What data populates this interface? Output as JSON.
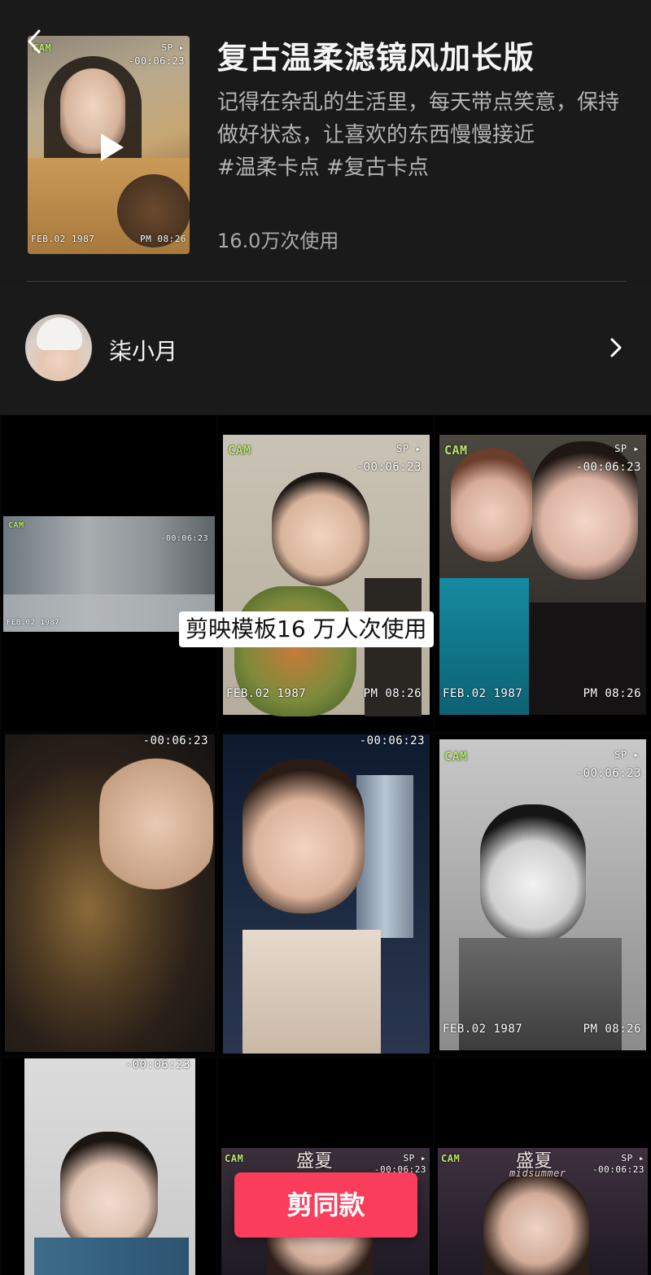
{
  "template": {
    "title": "复古温柔滤镜风加长版",
    "description": "记得在杂乱的生活里，每天带点笑意，保持做好状态，让喜欢的东西慢慢接近",
    "tags": "#温柔卡点 #复古卡点",
    "usage_count": "16.0万次使用"
  },
  "cover_overlay": {
    "cam": "CAM",
    "sp": "SP ▸",
    "counter": "-00:06:23",
    "date": "FEB.02 1987",
    "time": "PM 08:26"
  },
  "author": {
    "name": "柒小月"
  },
  "grid": {
    "caption": "剪映模板16 万人次使用",
    "overlay": {
      "cam": "CAM",
      "sp": "SP ▸",
      "counter": "-00:06:23",
      "date": "FEB.02 1987",
      "time": "PM 08:26"
    },
    "watermark": "盛夏",
    "watermark_sub": "midsummer"
  },
  "cta": {
    "label": "剪同款"
  },
  "icons": {
    "back": "back-arrow-icon",
    "play": "play-icon",
    "chevron": "chevron-right-icon"
  },
  "colors": {
    "accent": "#fb3d5c",
    "cam_green": "#b8e56a",
    "background": "#161616"
  }
}
